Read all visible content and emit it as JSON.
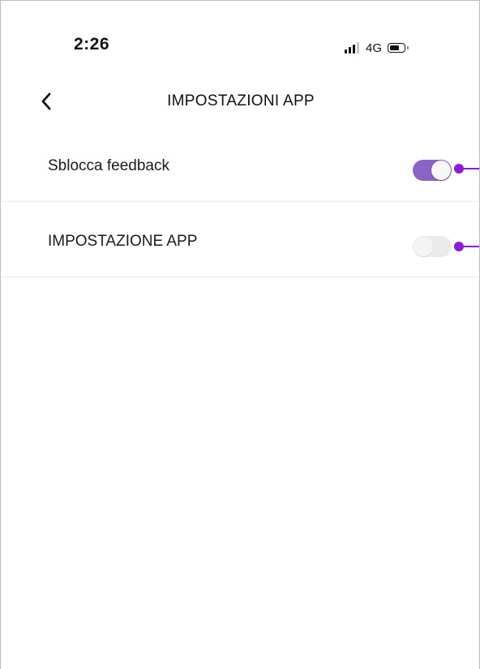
{
  "status_bar": {
    "time": "2:26",
    "network": "4G",
    "signal_icon": "signal-bars-icon",
    "battery_icon": "battery-icon"
  },
  "nav": {
    "back_icon": "chevron-left-icon",
    "title": "IMPOSTAZIONI APP"
  },
  "settings": [
    {
      "label": "Sblocca feedback",
      "enabled": true
    },
    {
      "label": "IMPOSTAZIONE APP",
      "enabled": false
    }
  ],
  "colors": {
    "toggle_on": "#8b62c7",
    "toggle_off": "#ebebeb",
    "annotation": "#8d1ad6"
  }
}
